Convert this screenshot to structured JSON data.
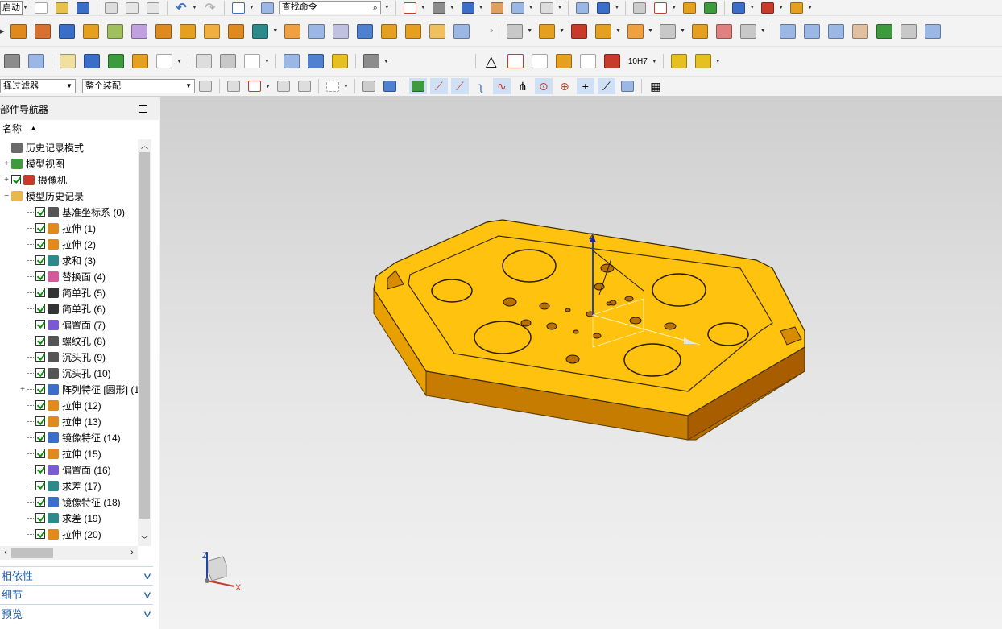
{
  "toolbar": {
    "start_menu": "启动",
    "search": {
      "value": "查找命令"
    },
    "filter": {
      "value": "择过滤器"
    },
    "assembly": {
      "value": "整个装配"
    },
    "tolerance_label": "10H7",
    "colors": {
      "blue": "#3a6ec8",
      "orange": "#e6a020",
      "green": "#3d9a3d",
      "gray": "#8c8c8c",
      "red": "#c83a2a"
    }
  },
  "navigator": {
    "title": "部件导航器",
    "column_header": "名称",
    "items": [
      {
        "label": "历史记录模式",
        "icon": "clock-icon",
        "level": 0,
        "expand": "",
        "check": false,
        "color": "#6a6a6a"
      },
      {
        "label": "模型视图",
        "icon": "model-views-icon",
        "level": 0,
        "expand": "+",
        "check": false,
        "color": "#3d9a3d"
      },
      {
        "label": "摄像机",
        "icon": "camera-icon",
        "level": 0,
        "expand": "+",
        "check": true,
        "color": "#c83a2a"
      },
      {
        "label": "模型历史记录",
        "icon": "folder-icon",
        "level": 0,
        "expand": "−",
        "check": false,
        "color": "#e8b84a"
      },
      {
        "label": "基准坐标系 (0)",
        "icon": "datum-csys-icon",
        "level": 1,
        "expand": "",
        "check": true,
        "color": "#555555"
      },
      {
        "label": "拉伸 (1)",
        "icon": "extrude-icon",
        "level": 1,
        "expand": "",
        "check": true,
        "color": "#e08a1e"
      },
      {
        "label": "拉伸 (2)",
        "icon": "extrude-icon",
        "level": 1,
        "expand": "",
        "check": true,
        "color": "#e08a1e"
      },
      {
        "label": "求和 (3)",
        "icon": "unite-icon",
        "level": 1,
        "expand": "",
        "check": true,
        "color": "#2d8a8a"
      },
      {
        "label": "替换面 (4)",
        "icon": "replace-face-icon",
        "level": 1,
        "expand": "",
        "check": true,
        "color": "#d05a9a"
      },
      {
        "label": "简单孔 (5)",
        "icon": "hole-icon",
        "level": 1,
        "expand": "",
        "check": true,
        "color": "#333333"
      },
      {
        "label": "简单孔 (6)",
        "icon": "hole-icon",
        "level": 1,
        "expand": "",
        "check": true,
        "color": "#333333"
      },
      {
        "label": "偏置面 (7)",
        "icon": "offset-face-icon",
        "level": 1,
        "expand": "",
        "check": true,
        "color": "#7a5ad0"
      },
      {
        "label": "螺纹孔 (8)",
        "icon": "threaded-hole-icon",
        "level": 1,
        "expand": "",
        "check": true,
        "color": "#555555"
      },
      {
        "label": "沉头孔 (9)",
        "icon": "counterbore-icon",
        "level": 1,
        "expand": "",
        "check": true,
        "color": "#555555"
      },
      {
        "label": "沉头孔 (10)",
        "icon": "counterbore-icon",
        "level": 1,
        "expand": "",
        "check": true,
        "color": "#555555"
      },
      {
        "label": "阵列特征 [圆形] (1",
        "icon": "pattern-feature-icon",
        "level": 1,
        "expand": "+",
        "check": true,
        "color": "#3a6ec8"
      },
      {
        "label": "拉伸 (12)",
        "icon": "extrude-icon",
        "level": 1,
        "expand": "",
        "check": true,
        "color": "#e08a1e"
      },
      {
        "label": "拉伸 (13)",
        "icon": "extrude-icon",
        "level": 1,
        "expand": "",
        "check": true,
        "color": "#e08a1e"
      },
      {
        "label": "镜像特征 (14)",
        "icon": "mirror-feature-icon",
        "level": 1,
        "expand": "",
        "check": true,
        "color": "#3a6ec8"
      },
      {
        "label": "拉伸 (15)",
        "icon": "extrude-icon",
        "level": 1,
        "expand": "",
        "check": true,
        "color": "#e08a1e"
      },
      {
        "label": "偏置面 (16)",
        "icon": "offset-face-icon",
        "level": 1,
        "expand": "",
        "check": true,
        "color": "#7a5ad0"
      },
      {
        "label": "求差 (17)",
        "icon": "subtract-icon",
        "level": 1,
        "expand": "",
        "check": true,
        "color": "#2d8a8a"
      },
      {
        "label": "镜像特征 (18)",
        "icon": "mirror-feature-icon",
        "level": 1,
        "expand": "",
        "check": true,
        "color": "#3a6ec8"
      },
      {
        "label": "求差 (19)",
        "icon": "subtract-icon",
        "level": 1,
        "expand": "",
        "check": true,
        "color": "#2d8a8a"
      },
      {
        "label": "拉伸 (20)",
        "icon": "extrude-icon",
        "level": 1,
        "expand": "",
        "check": true,
        "color": "#e08a1e"
      }
    ]
  },
  "panels": {
    "dependencies": "相依性",
    "details": "细节",
    "preview": "预览"
  },
  "viewport": {
    "axis_z": "Z",
    "axis_x": "X",
    "part_color": "#ffc20e",
    "part_side_color": "#d88a00"
  }
}
